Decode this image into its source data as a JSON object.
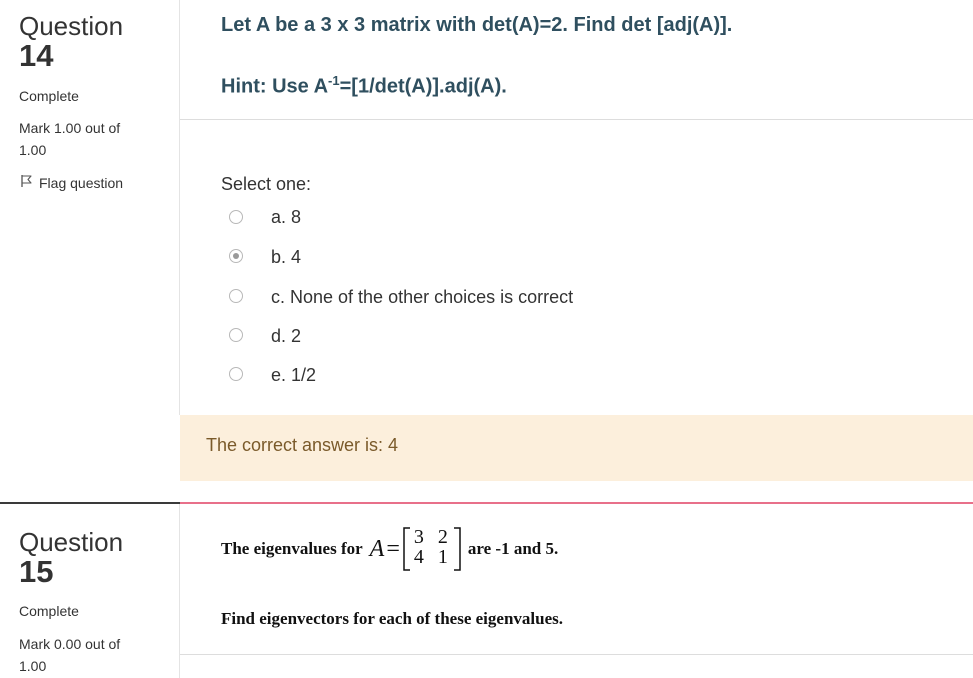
{
  "question14": {
    "label_word": "Question",
    "number": "14",
    "status": "Complete",
    "mark_line1": "Mark 1.00 out of",
    "mark_line2": "1.00",
    "flag_label": "Flag question",
    "question_text": "Let A be a 3 x 3 matrix with det(A)=2. Find det [adj(A)].",
    "hint_prefix": "Hint: Use A",
    "hint_sup": "-1",
    "hint_suffix": "=[1/det(A)].adj(A).",
    "select_prompt": "Select one:",
    "options": [
      {
        "label": "a. 8",
        "checked": false
      },
      {
        "label": "b. 4",
        "checked": true
      },
      {
        "label": "c. None of the other choices is correct",
        "checked": false
      },
      {
        "label": "d. 2",
        "checked": false
      },
      {
        "label": "e. 1/2",
        "checked": false
      }
    ],
    "feedback": "The correct answer is: 4"
  },
  "question15": {
    "label_word": "Question",
    "number": "15",
    "status": "Complete",
    "mark_line1": "Mark 0.00 out of",
    "mark_line2": "1.00",
    "text_before": "The eigenvalues for",
    "matrix_var": "A",
    "matrix_eq": "=",
    "matrix": [
      [
        "3",
        "2"
      ],
      [
        "4",
        "1"
      ]
    ],
    "text_after": "are -1 and 5.",
    "instruction": "Find eigenvectors for each of these eigenvalues."
  },
  "colors": {
    "question_text": "#2f4f5f",
    "feedback_bg": "#fcefdc",
    "feedback_text": "#7a5a2a",
    "divider_accent": "#e8708a"
  },
  "icons": {
    "flag": "flag-outline-icon"
  }
}
